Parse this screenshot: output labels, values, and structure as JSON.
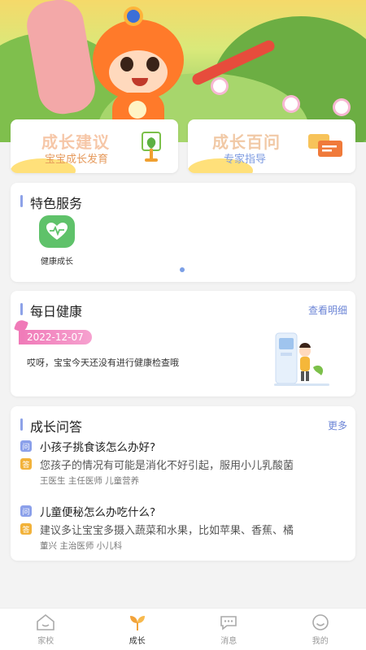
{
  "growth_advice": {
    "title": "成长建议",
    "subtitle": "宝宝成长发育"
  },
  "growth_faq": {
    "title": "成长百问",
    "subtitle": "专家指导"
  },
  "services": {
    "title": "特色服务",
    "items": [
      {
        "label": "健康成长",
        "icon": "heart-pulse-icon"
      }
    ]
  },
  "daily_health": {
    "title": "每日健康",
    "link": "查看明细",
    "date": "2022-12-07",
    "message": "哎呀，宝宝今天还没有进行健康检查哦"
  },
  "qa": {
    "title": "成长问答",
    "link": "更多",
    "q_tag": "问",
    "a_tag": "答",
    "items": [
      {
        "question": "小孩子挑食该怎么办好?",
        "answer": "您孩子的情况有可能是消化不好引起，服用小儿乳酸菌",
        "doctor": "王医生 主任医师 儿童营养"
      },
      {
        "question": "儿童便秘怎么办吃什么?",
        "answer": "建议多让宝宝多摄入蔬菜和水果，比如苹果、香蕉、橘",
        "doctor": "董兴 主治医师 小儿科"
      }
    ]
  },
  "tabbar": {
    "active": "成长",
    "items": [
      {
        "label": "家校",
        "icon": "home-icon"
      },
      {
        "label": "成长",
        "icon": "sprout-icon"
      },
      {
        "label": "消息",
        "icon": "chat-bubble-icon"
      },
      {
        "label": "我的",
        "icon": "smiley-icon"
      }
    ]
  },
  "colors": {
    "accent": "#8da2e8",
    "orange": "#ff7a2a",
    "pink": "#f07ab8",
    "green": "#5fc26a"
  }
}
